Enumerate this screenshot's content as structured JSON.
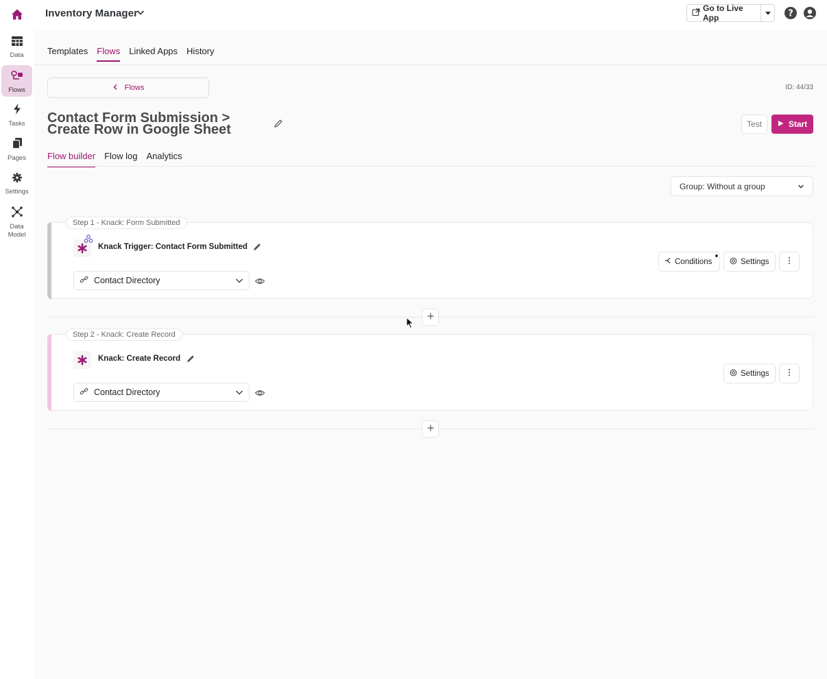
{
  "header": {
    "app_title": "Inventory Manager",
    "live_app_label": "Go to Live App"
  },
  "sidebar": {
    "items": [
      {
        "label": "Data",
        "icon": "table-icon"
      },
      {
        "label": "Flows",
        "icon": "flows-icon",
        "active": true
      },
      {
        "label": "Tasks",
        "icon": "bolt-icon"
      },
      {
        "label": "Pages",
        "icon": "pages-icon"
      },
      {
        "label": "Settings",
        "icon": "gear-icon"
      },
      {
        "label": "Data Model",
        "icon": "data-model-icon"
      }
    ]
  },
  "tabs": [
    "Templates",
    "Flows",
    "Linked Apps",
    "History"
  ],
  "active_tab": "Flows",
  "back_label": "Flows",
  "flow_id": "ID: 44/33",
  "flow_title": "Contact Form Submission > Create Row in Google Sheet",
  "test_label": "Test",
  "start_label": "Start",
  "subtabs": [
    "Flow builder",
    "Flow log",
    "Analytics"
  ],
  "active_subtab": "Flow builder",
  "group_select": "Group: Without a group",
  "steps": [
    {
      "label": "Step 1 - Knack: Form Submitted",
      "name": "Knack Trigger: Contact Form Submitted",
      "connection": "Contact Directory",
      "conditions_label": "Conditions",
      "settings_label": "Settings",
      "accent": "#c8c8c8"
    },
    {
      "label": "Step 2 - Knack: Create Record",
      "name": "Knack: Create Record",
      "connection": "Contact Directory",
      "settings_label": "Settings",
      "accent": "#f0c6e4"
    }
  ],
  "colors": {
    "brand": "#a1156e",
    "start": "#c0267f",
    "icon_asterisk": "#9a1c78"
  }
}
